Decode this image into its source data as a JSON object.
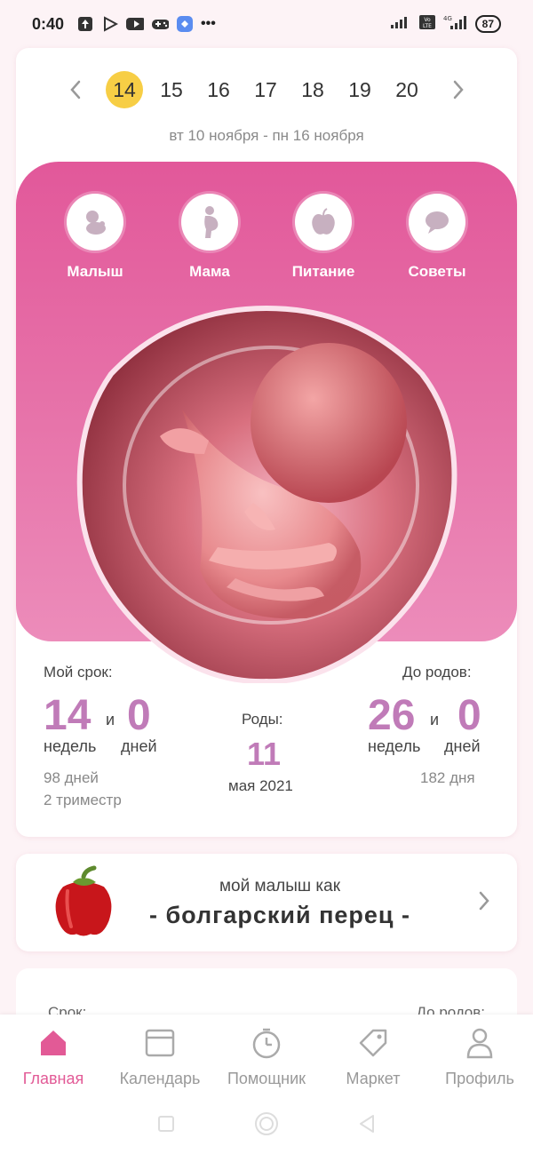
{
  "status_bar": {
    "time": "0:40",
    "more": "•••",
    "battery": "87"
  },
  "week_nav": {
    "weeks": [
      "14",
      "15",
      "16",
      "17",
      "18",
      "19",
      "20"
    ],
    "active_index": 0
  },
  "date_range": "вт 10 ноября - пн 16 ноября",
  "categories": [
    {
      "label": "Малыш",
      "icon": "baby-icon"
    },
    {
      "label": "Мама",
      "icon": "pregnant-icon"
    },
    {
      "label": "Питание",
      "icon": "apple-icon"
    },
    {
      "label": "Советы",
      "icon": "chat-bubble-icon"
    }
  ],
  "stats": {
    "my_term_label": "Мой срок:",
    "my_weeks": "14",
    "my_days": "0",
    "and": "и",
    "weeks_unit": "недель",
    "days_unit": "дней",
    "days_total": "98 дней",
    "trimester": "2 триместр",
    "birth_label": "Роды:",
    "birth_day": "11",
    "birth_month": "мая 2021",
    "until_label": "До родов:",
    "until_weeks": "26",
    "until_days": "0",
    "until_total": "182 дня"
  },
  "fruit": {
    "top": "мой малыш как",
    "name": "- болгарский перец -"
  },
  "peek": {
    "left": "Срок:",
    "right": "До родов:"
  },
  "tabs": [
    {
      "label": "Главная",
      "icon": "home-icon"
    },
    {
      "label": "Календарь",
      "icon": "calendar-icon"
    },
    {
      "label": "Помощник",
      "icon": "timer-icon"
    },
    {
      "label": "Маркет",
      "icon": "tag-icon"
    },
    {
      "label": "Профиль",
      "icon": "profile-icon"
    }
  ],
  "colors": {
    "accent": "#e25a96",
    "number": "#c07bb8",
    "highlight": "#f7ce45"
  }
}
